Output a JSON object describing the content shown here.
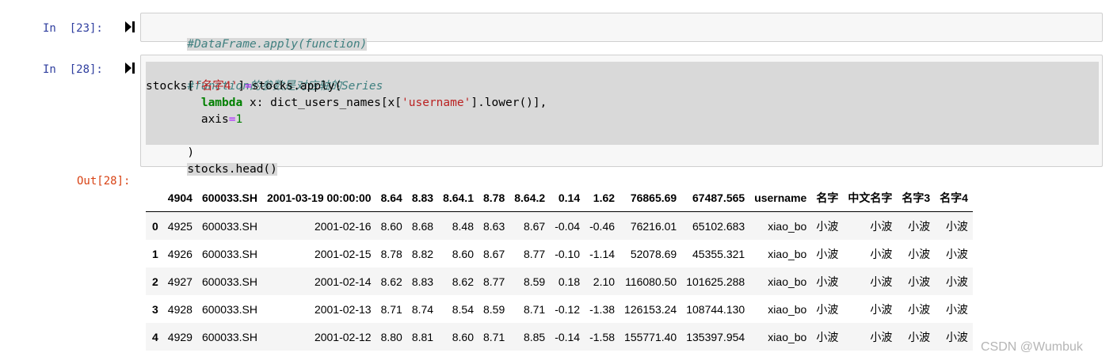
{
  "cells": [
    {
      "prompt": "In  [23]:",
      "code_lines": [
        "#DataFrame.apply(function)"
      ]
    },
    {
      "prompt": "In  [28]:",
      "code": {
        "line1": "#function的参数是对应轴的Series",
        "line2_a": "stocks[",
        "line2_str": "'名字4'",
        "line2_b": "]",
        "line2_op": "=",
        "line2_c": "stocks.apply(",
        "line3_indent": "        ",
        "line3_kw": "lambda",
        "line3_a": " x: dict_users_names[x[",
        "line3_str": "'username'",
        "line3_b": "].lower()],",
        "line4_a": "        axis",
        "line4_op": "=",
        "line4_num": "1",
        "line5": ")",
        "line6": "stocks.head()"
      }
    }
  ],
  "output": {
    "prompt": "Out[28]:",
    "columns": [
      "",
      "4904",
      "600033.SH",
      "2001-03-19 00:00:00",
      "8.64",
      "8.83",
      "8.64.1",
      "8.78",
      "8.64.2",
      "0.14",
      "1.62",
      "76865.69",
      "67487.565",
      "username",
      "名字",
      "中文名字",
      "名字3",
      "名字4"
    ],
    "rows": [
      [
        "0",
        "4925",
        "600033.SH",
        "2001-02-16",
        "8.60",
        "8.68",
        "8.48",
        "8.63",
        "8.67",
        "-0.04",
        "-0.46",
        "76216.01",
        "65102.683",
        "xiao_bo",
        "小波",
        "小波",
        "小波",
        "小波"
      ],
      [
        "1",
        "4926",
        "600033.SH",
        "2001-02-15",
        "8.78",
        "8.82",
        "8.60",
        "8.67",
        "8.77",
        "-0.10",
        "-1.14",
        "52078.69",
        "45355.321",
        "xiao_bo",
        "小波",
        "小波",
        "小波",
        "小波"
      ],
      [
        "2",
        "4927",
        "600033.SH",
        "2001-02-14",
        "8.62",
        "8.83",
        "8.62",
        "8.77",
        "8.59",
        "0.18",
        "2.10",
        "116080.50",
        "101625.288",
        "xiao_bo",
        "小波",
        "小波",
        "小波",
        "小波"
      ],
      [
        "3",
        "4928",
        "600033.SH",
        "2001-02-13",
        "8.71",
        "8.74",
        "8.54",
        "8.59",
        "8.71",
        "-0.12",
        "-1.38",
        "126153.24",
        "108744.130",
        "xiao_bo",
        "小波",
        "小波",
        "小波",
        "小波"
      ],
      [
        "4",
        "4929",
        "600033.SH",
        "2001-02-12",
        "8.80",
        "8.81",
        "8.60",
        "8.71",
        "8.85",
        "-0.14",
        "-1.58",
        "155771.40",
        "135397.954",
        "xiao_bo",
        "小波",
        "小波",
        "小波",
        "小波"
      ]
    ]
  },
  "watermark": "CSDN @Wumbuk"
}
